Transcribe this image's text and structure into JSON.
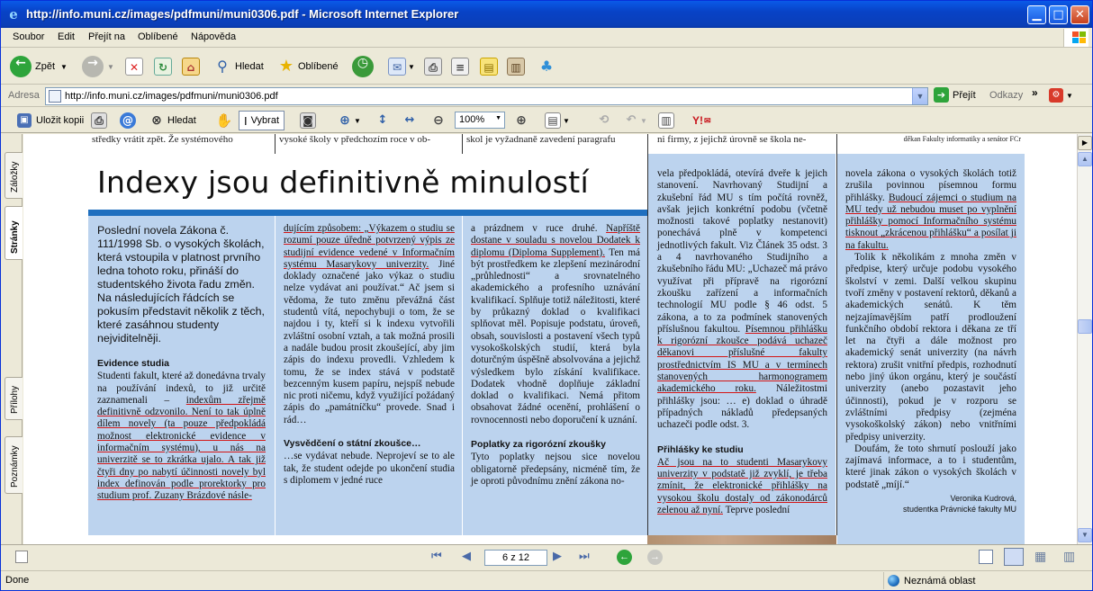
{
  "window": {
    "title": "http://info.muni.cz/images/pdfmuni/muni0306.pdf - Microsoft Internet Explorer"
  },
  "menu": [
    "Soubor",
    "Edit",
    "Přejít na",
    "Oblíbené",
    "Nápověda"
  ],
  "toolbar": {
    "back": "Zpět",
    "search": "Hledat",
    "favorites": "Oblíbené"
  },
  "address": {
    "label": "Adresa",
    "url": "http://info.muni.cz/images/pdfmuni/muni0306.pdf",
    "go": "Přejít",
    "links": "Odkazy"
  },
  "pdf_toolbar": {
    "save_copy": "Uložit kopii",
    "search": "Hledat",
    "select": "Vybrat",
    "zoom": "100%"
  },
  "side_tabs": [
    "Záložky",
    "Stránky",
    "Přílohy",
    "Poznámky"
  ],
  "navigation": {
    "page": "6 z 12"
  },
  "status": {
    "left": "Done",
    "zone": "Neznámá oblast"
  },
  "article": {
    "top_strip": [
      "středky vrátit zpět. Že systémového",
      "vysoké školy v předchozím roce v ob-",
      "skol je vyžadnaně zavedení paragrafu",
      "ni firmy, z jejichž úrovně se škola ne-",
      "děkan Fakulty informatiky a senátor FCr"
    ],
    "headline": "Indexy jsou definitivně minulostí",
    "lead": "Poslední novela Zákona č. 111/1998 Sb. o vysokých školách, která vstoupila v platnost prvního ledna tohoto roku, přináší do studentského života řadu změn. Na následujících řádcích se pokusím představit několik z těch, které zasáhnou studenty nejviditelněji.",
    "col1_heading": "Evidence studia",
    "col1_a": "Studenti fakult, které až donedávna trvaly na používání indexů, to již určitě zaznamenali – ",
    "col1_u": "indexům zřejmě definitivně odzvonilo. Není to tak úplně dílem novely (ta pouze předpokládá možnost elektronické evidence v informačním systému), u nás na univerzitě se to zkrátka ujalo. A tak již čtyři dny po nabytí účinnosti novely byl index definován podle prorektorky pro studium prof. Zuzany Brázdové násle-",
    "col2_u": "dujícím způsobem: „Výkazem o studiu se rozumí pouze úředně potvrzený výpis ze studijní evidence vedené v Informačním systému Masarykovy univerzity.",
    "col2_a": " Jiné doklady označené jako výkaz o studiu nelze vydávat ani používat.“ Ač jsem si vědoma, že tuto změnu převážná část studentů vítá, nepochybuji o tom, že se najdou i ty, kteří si k indexu vytvořili zvláštní osobní vztah, a tak možná prosili a nadále budou prosit zkoušející, aby jim zápis do indexu provedli. Vzhledem k tomu, že se index stává v podstatě bezcenným kusem papíru, nejspíš nebude nic proti ničemu, když využijící požádaný zápis do „památníčku“ provede. Snad i rád…",
    "col2_heading": "Vysvědčení o státní zkoušce…",
    "col2_b": "…se vydávat nebude. Neprojeví se to ale tak, že student odejde po ukončení studia s diplomem v jedné ruce",
    "col3_a": "a prázdnem v ruce druhé. ",
    "col3_u": "Napříště dostane v souladu s novelou Dodatek k diplomu (Diploma Supplement).",
    "col3_b": " Ten má být prostředkem ke zlepšení mezinárodní „průhlednosti“ a srovnatelného akademického a profesního uznávání kvalifikací. Splňuje totiž náležitosti, které by průkazný doklad o kvalifikaci splňovat měl. Popisuje podstatu, úroveň, obsah, souvislosti a postavení všech typů vysokoškolských studií, která byla doturčným úspěšně absolvována a jejichž výsledkem bylo získání kvalifikace. Dodatek vhodně doplňuje základní doklad o kvalifikaci. Nemá přitom obsahovat žádné ocenění, prohlášení o rovnocennosti nebo doporučení k uznání.",
    "col3_heading": "Poplatky za rigorózní zkoušky",
    "col3_c": "Tyto poplatky nejsou sice novelou obligatorně předepsány, nicméně tím, že je oproti původnímu znění zákona no-",
    "col4_a": "vela předpokládá, otevírá dveře k jejich stanovení. Navrhovaný Studijní a zkušební řád MU s tím počítá rovněž, avšak jejich konkrétní podobu (včetně možnosti takové poplatky nestanovit) ponechává plně v kompetenci jednotlivých fakult. Viz Článek 35 odst. 3 a 4 navrhovaného Studijního a zkušebního řádu MU: „Uchazeč má právo využívat při přípravě na rigorózní zkoušku zařízení a informačních technologií MU podle § 46 odst. 5 zákona, a to za podmínek stanovených příslušnou fakultou. ",
    "col4_u": "Písemnou přihlášku k rigorózní zkoušce podává uchazeč děkanovi příslušné fakulty prostřednictvím IS MU a v termínech stanovených harmonogramem akademického roku.",
    "col4_b": " Náležitostmi přihlášky jsou: … e) doklad o úhradě případných nákladů předepsaných uchazeči podle odst. 3.",
    "col4_heading": "Přihlášky ke studiu",
    "col4_u2": "Ač jsou na to studenti Masarykovy univerzity v podstatě již zvyklí, je třeba zmínit, že elektronické přihlášky na vysokou školu dostaly od zákonodárců zelenou až nyní.",
    "col4_c": " Teprve poslední",
    "col5_a": "novela zákona o vysokých školách totiž zrušila povinnou písemnou formu přihlášky. ",
    "col5_u": "Budoucí zájemci o studium na MU tedy už nebudou muset po vyplnění přihlášky pomocí Informačního systému tisknout „zkrácenou přihlášku“ a posílat ji na fakultu.",
    "col5_b": "Tolik k několikám z mnoha změn v předpise, který určuje podobu vysokého školství v zemi. Další velkou skupinu tvoří změny v postavení rektorů, děkanů a akademických senátů. K těm nejzajímavějším patří prodloužení funkčního období rektora i děkana ze tří let na čtyři a dále možnost pro akademický senát univerzity (na návrh rektora) zrušit vnitřní předpis, rozhodnutí nebo jiný úkon orgánu, který je součástí univerzity (anebo pozastavit jeho účinnosti), pokud je v rozporu se zvláštními předpisy (zejména vysokoškolský zákon) nebo vnitřními předpisy univerzity.",
    "col5_c": "Doufám, že toto shrnutí poslouží jako zajímavá informace, a to i studentům, které jinak zákon o vysokých školách v podstatě „míjí.“",
    "author": "Veronika Kudrová,",
    "author_role": "studentka Právnické fakulty MU"
  }
}
